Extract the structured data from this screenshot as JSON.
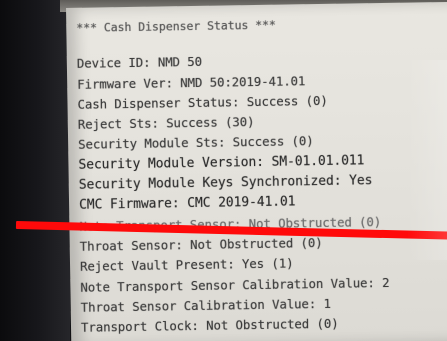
{
  "screen": {
    "header": "*** Cash Dispenser Status ***",
    "lines": [
      "Device ID: NMD 50",
      "Firmware Ver: NMD 50:2019-41.01",
      "Cash Dispenser Status: Success (0)",
      "Reject Sts: Success (30)",
      "Security Module Sts: Success (0)",
      "Security Module Version: SM-01.01.011",
      "Security Module Keys Synchronized: Yes",
      "CMC Firmware: CMC 2019-41.01",
      "Note Transport Sensor: Not Obstructed (0)",
      "Throat Sensor: Not Obstructed (0)",
      "Reject Vault Present: Yes (1)",
      "Note Transport Sensor Calibration Value: 2",
      "Throat Sensor Calibration Value: 1",
      "Transport Clock: Not Obstructed (0)"
    ]
  },
  "colors": {
    "screen_bg": "#e6e4de",
    "text": "#3a3a3a",
    "redaction_bar": "#ff0a0a"
  }
}
